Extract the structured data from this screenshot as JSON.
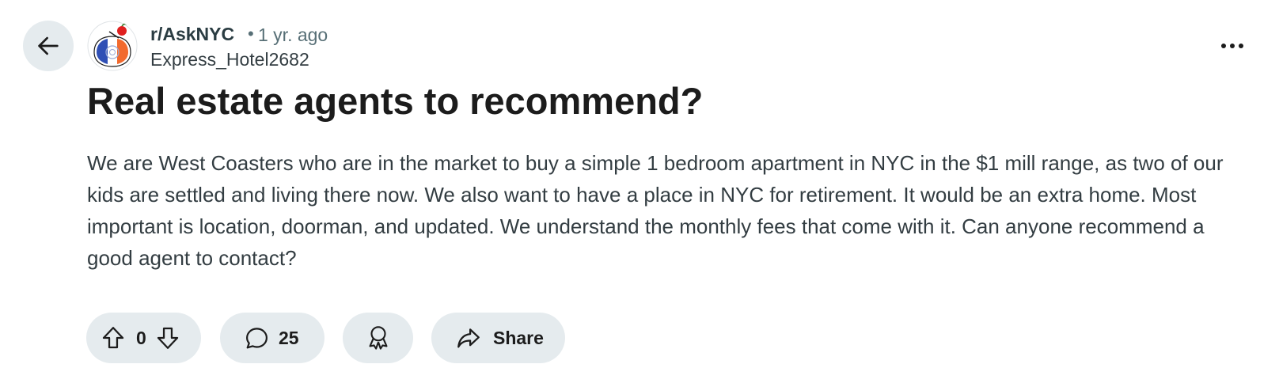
{
  "post": {
    "subreddit": "r/AskNYC",
    "separator": "•",
    "age": "1 yr. ago",
    "author": "Express_Hotel2682",
    "title": "Real estate agents to recommend?",
    "body": "We are West Coasters who are in the market to buy a simple 1 bedroom apartment in NYC in the $1 mill range, as two of our kids are settled and living there now. We also want to have a place in NYC for retirement. It would be an extra home. Most important is location, doorman, and updated. We understand the monthly fees that come with it. Can anyone recommend a good agent to contact?"
  },
  "actions": {
    "vote_count": "0",
    "comment_count": "25",
    "share_label": "Share"
  },
  "icons": {
    "back": "arrow-left-icon",
    "more": "more-horizontal-icon",
    "upvote": "upvote-arrow-icon",
    "downvote": "downvote-arrow-icon",
    "comment": "comment-bubble-icon",
    "award": "award-icon",
    "share": "share-arrow-icon"
  },
  "colors": {
    "pill_background": "#e5ebee",
    "text_primary": "#1c1c1c",
    "text_meta": "#576f76",
    "avatar_blue": "#2f4fb5",
    "avatar_orange": "#f26a2e"
  }
}
